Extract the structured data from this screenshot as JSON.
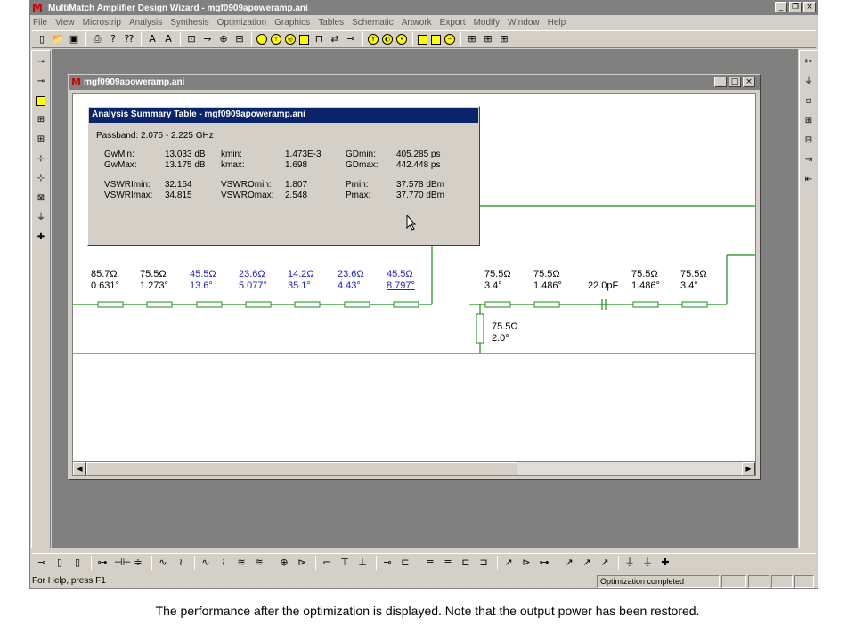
{
  "app": {
    "title": "MultiMatch Amplifier Design Wizard - mgf0909apoweramp.ani",
    "window_buttons": [
      "_",
      "̅̅",
      "x"
    ]
  },
  "menu": [
    "File",
    "View",
    "Microstrip",
    "Analysis",
    "Synthesis",
    "Optimization",
    "Graphics",
    "Tables",
    "Schematic",
    "Artwork",
    "Export",
    "Modify",
    "Window",
    "Help"
  ],
  "child": {
    "title": "mgf0909apoweramp.ani"
  },
  "dialog": {
    "title": "Analysis Summary Table - mgf0909apoweramp.ani",
    "passband": "Passband: 2.075 - 2.225 GHz",
    "rows": [
      [
        "GwMin:",
        "13.033 dB",
        "kmin:",
        "1.473E-3",
        "GDmin:",
        "405.285 ps"
      ],
      [
        "GwMax:",
        "13.175 dB",
        "kmax:",
        "1.698",
        "GDmax:",
        "442.448 ps"
      ],
      [
        "VSWRImin:",
        "32.154",
        "VSWROmin:",
        "1.807",
        "Pmin:",
        "37.578 dBm"
      ],
      [
        "VSWRImax:",
        "34.815",
        "VSWROmax:",
        "2.548",
        "Pmax:",
        "37.770 dBm"
      ]
    ]
  },
  "circuit": {
    "elements": [
      {
        "imp": "85.7Ω",
        "ang": "0.631°",
        "color": "black"
      },
      {
        "imp": "75.5Ω",
        "ang": "1.273°",
        "color": "black"
      },
      {
        "imp": "45.5Ω",
        "ang": "13.6°",
        "color": "blue"
      },
      {
        "imp": "23.6Ω",
        "ang": "5.077°",
        "color": "blue"
      },
      {
        "imp": "14.2Ω",
        "ang": "35.1°",
        "color": "blue"
      },
      {
        "imp": "23.6Ω",
        "ang": "4.43°",
        "color": "blue"
      },
      {
        "imp": "45.5Ω",
        "ang": "8.797°",
        "color": "blue"
      },
      {
        "imp": "75.5Ω",
        "ang": "3.4°",
        "color": "black"
      },
      {
        "imp": "75.5Ω",
        "ang": "1.486°",
        "color": "black"
      },
      {
        "imp": "",
        "ang": "22.0pF",
        "color": "black"
      },
      {
        "imp": "75.5Ω",
        "ang": "1.486°",
        "color": "black"
      },
      {
        "imp": "75.5Ω",
        "ang": "3.4°",
        "color": "black"
      }
    ],
    "shunt": {
      "imp": "75.5Ω",
      "ang": "2.0°"
    }
  },
  "status": {
    "help": "For Help, press F1",
    "message": "Optimization completed"
  },
  "caption": "The performance after the optimization is displayed. Note that the output power has been restored."
}
